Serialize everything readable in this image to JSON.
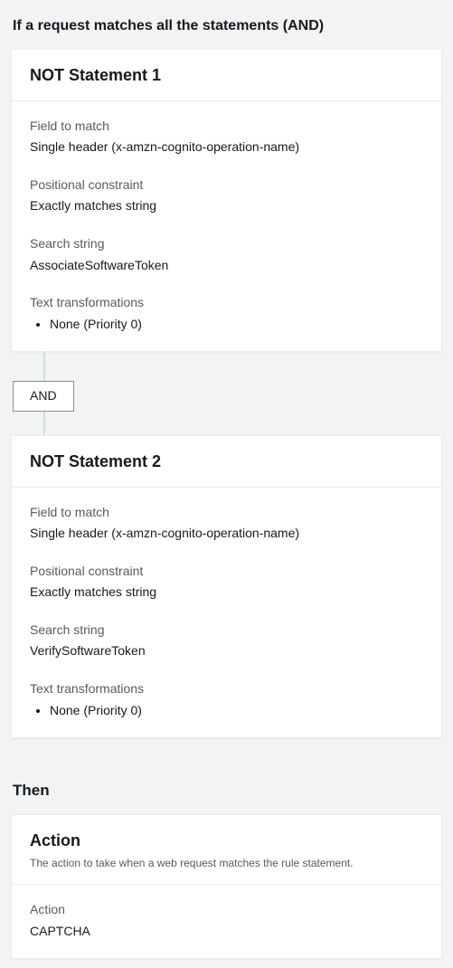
{
  "conditionHeading": "If a request matches all the statements (AND)",
  "statements": [
    {
      "title": "NOT Statement 1",
      "fields": {
        "fieldToMatch": {
          "label": "Field to match",
          "value": "Single header (x-amzn-cognito-operation-name)"
        },
        "positionalConstraint": {
          "label": "Positional constraint",
          "value": "Exactly matches string"
        },
        "searchString": {
          "label": "Search string",
          "value": "AssociateSoftwareToken"
        },
        "textTransformations": {
          "label": "Text transformations",
          "value": "None (Priority 0)"
        }
      }
    },
    {
      "title": "NOT Statement 2",
      "fields": {
        "fieldToMatch": {
          "label": "Field to match",
          "value": "Single header (x-amzn-cognito-operation-name)"
        },
        "positionalConstraint": {
          "label": "Positional constraint",
          "value": "Exactly matches string"
        },
        "searchString": {
          "label": "Search string",
          "value": "VerifySoftwareToken"
        },
        "textTransformations": {
          "label": "Text transformations",
          "value": "None (Priority 0)"
        }
      }
    }
  ],
  "connectorLabel": "AND",
  "thenHeading": "Then",
  "action": {
    "title": "Action",
    "subtitle": "The action to take when a web request matches the rule statement.",
    "field": {
      "label": "Action",
      "value": "CAPTCHA"
    }
  }
}
